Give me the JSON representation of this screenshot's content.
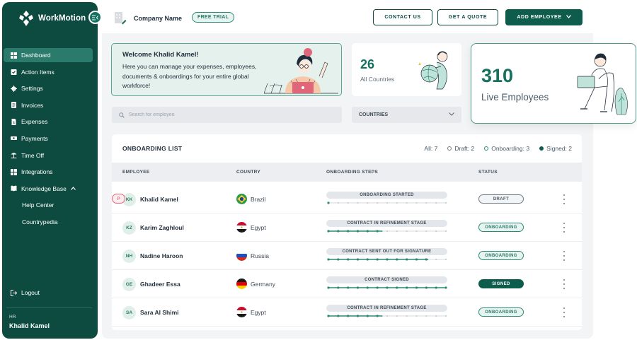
{
  "colors": {
    "brand": "#0d4a40",
    "accent": "#15705d",
    "progress": "#2a8a75"
  },
  "sidebar": {
    "brand": "WorkMotion",
    "items": [
      {
        "label": "Dashboard",
        "icon": "grid-icon"
      },
      {
        "label": "Action Items",
        "icon": "clipboard-check-icon"
      },
      {
        "label": "Settings",
        "icon": "gear-icon"
      },
      {
        "label": "Invoices",
        "icon": "invoice-icon"
      },
      {
        "label": "Expenses",
        "icon": "receipt-icon"
      },
      {
        "label": "Payments",
        "icon": "cash-icon"
      },
      {
        "label": "Time Off",
        "icon": "beach-icon"
      },
      {
        "label": "Integrations",
        "icon": "apps-icon"
      },
      {
        "label": "Knowledge Base",
        "icon": "book-icon"
      },
      {
        "label": "Help Center"
      },
      {
        "label": "Countrypedia"
      }
    ],
    "logout": "Logout",
    "user_role": "HR",
    "user_name": "Khalid Kamel"
  },
  "header": {
    "company": "Company Name",
    "trial_badge": "FREE TRIAL",
    "contact_label": "CONTACT US",
    "quote_label": "GET A QUOTE",
    "add_employee_label": "ADD EMPLOYEE"
  },
  "welcome": {
    "title": "Welcome Khalid Kamel!",
    "text": "Here you can manage your expenses, employees, documents & onboardings for your entire global workforce!"
  },
  "stats": {
    "countries_value": "26",
    "countries_label": "All Countries",
    "employees_value": "310",
    "employees_label": "Live Employees"
  },
  "search": {
    "placeholder": "Search for employee"
  },
  "countries_filter": {
    "label": "COUNTRIES"
  },
  "onboarding": {
    "title": "ONBOARDING LIST",
    "filters": {
      "all": "All: 7",
      "draft": "Draft: 2",
      "onboarding": "Onboarding: 3",
      "signed": "Signed: 2"
    },
    "columns": {
      "employee": "EMPLOYEE",
      "country": "COUNTRY",
      "steps": "ONBOARDING STEPS",
      "status": "STATUS"
    },
    "rows": [
      {
        "initials": "KK",
        "name": "Khalid Kamel",
        "badge": "P",
        "country": "Brazil",
        "flag": "brazil",
        "step": "ONBOARDING STARTED",
        "progress": 0.0,
        "status": "DRAFT",
        "status_type": "draft"
      },
      {
        "initials": "KZ",
        "name": "Karim Zaghloul",
        "badge": "",
        "country": "Egypt",
        "flag": "egypt",
        "step": "CONTRACT IN REFINEMENT STAGE",
        "progress": 0.46,
        "status": "ONBOARDING",
        "status_type": "onboarding"
      },
      {
        "initials": "NH",
        "name": "Nadine Haroon",
        "badge": "",
        "country": "Russia",
        "flag": "russia",
        "step": "CONTRACT SENT OUT FOR SIGNATURE",
        "progress": 0.85,
        "status": "ONBOARDING",
        "status_type": "onboarding"
      },
      {
        "initials": "GE",
        "name": "Ghadeer Essa",
        "badge": "",
        "country": "Germany",
        "flag": "germany",
        "step": "CONTRACT SIGNED",
        "progress": 1.0,
        "status": "SIGNED",
        "status_type": "signed"
      },
      {
        "initials": "SA",
        "name": "Sara Al Shimi",
        "badge": "",
        "country": "Egypt",
        "flag": "egypt",
        "step": "CONTRACT IN REFINEMENT STAGE",
        "progress": 0.46,
        "status": "ONBOARDING",
        "status_type": "onboarding"
      }
    ]
  }
}
